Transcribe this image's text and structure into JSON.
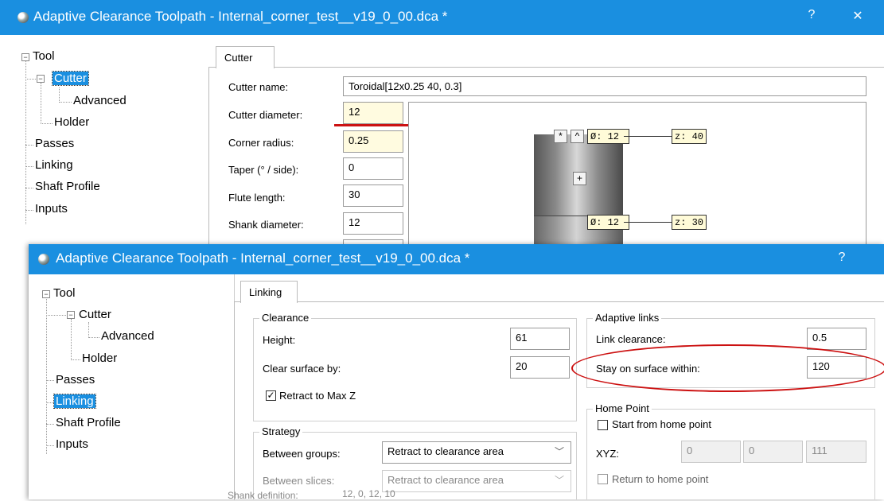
{
  "back_window": {
    "title": "Adaptive Clearance Toolpath - Internal_corner_test__v19_0_00.dca *",
    "help_label": "?",
    "close_label": "✕",
    "tree": {
      "tool": "Tool",
      "cutter": "Cutter",
      "advanced": "Advanced",
      "holder": "Holder",
      "passes": "Passes",
      "linking": "Linking",
      "shaft_profile": "Shaft Profile",
      "inputs": "Inputs"
    },
    "tab": "Cutter",
    "fields": {
      "cutter_name_label": "Cutter name:",
      "cutter_name_value": "Toroidal[12x0.25 40, 0.3]",
      "cutter_diameter_label": "Cutter diameter:",
      "cutter_diameter_value": "12",
      "corner_radius_label": "Corner radius:",
      "corner_radius_value": "0.25",
      "taper_label": "Taper (° / side):",
      "taper_value": "0",
      "flute_length_label": "Flute length:",
      "flute_length_value": "30",
      "shank_diameter_label": "Shank diameter:",
      "shank_diameter_value": "12"
    },
    "preview": {
      "star_btn": "*",
      "caret_btn": "^",
      "dia_top": "Ø: 12",
      "z_top": "z: 40",
      "plus_btn": "+",
      "dia_bottom": "Ø: 12",
      "z_bottom": "z: 30"
    },
    "shank_definition_label": "Shank definition:",
    "shank_definition_value": "12, 0, 12, 10"
  },
  "front_window": {
    "title": "Adaptive Clearance Toolpath - Internal_corner_test__v19_0_00.dca *",
    "help_label": "?",
    "tree": {
      "tool": "Tool",
      "cutter": "Cutter",
      "advanced": "Advanced",
      "holder": "Holder",
      "passes": "Passes",
      "linking": "Linking",
      "shaft_profile": "Shaft Profile",
      "inputs": "Inputs"
    },
    "tab": "Linking",
    "clearance": {
      "title": "Clearance",
      "height_label": "Height:",
      "height_value": "61",
      "clear_surface_label": "Clear surface by:",
      "clear_surface_value": "20",
      "retract_label": "Retract to Max Z",
      "retract_checked": true
    },
    "strategy": {
      "title": "Strategy",
      "between_groups_label": "Between groups:",
      "between_groups_value": "Retract to clearance area",
      "between_slices_label": "Between slices:",
      "between_slices_value": "Retract to clearance area"
    },
    "adaptive_links": {
      "title": "Adaptive links",
      "link_clearance_label": "Link clearance:",
      "link_clearance_value": "0.5",
      "stay_on_surface_label": "Stay on surface within:",
      "stay_on_surface_value": "120"
    },
    "home_point": {
      "title": "Home Point",
      "start_label": "Start from home point",
      "xyz_label": "XYZ:",
      "x": "0",
      "y": "0",
      "z": "111",
      "return_label": "Return to home point"
    }
  },
  "colors": {
    "titlebar": "#1a8fe0",
    "highlight_red": "#cc1111",
    "input_yellow": "#fffbe0"
  }
}
